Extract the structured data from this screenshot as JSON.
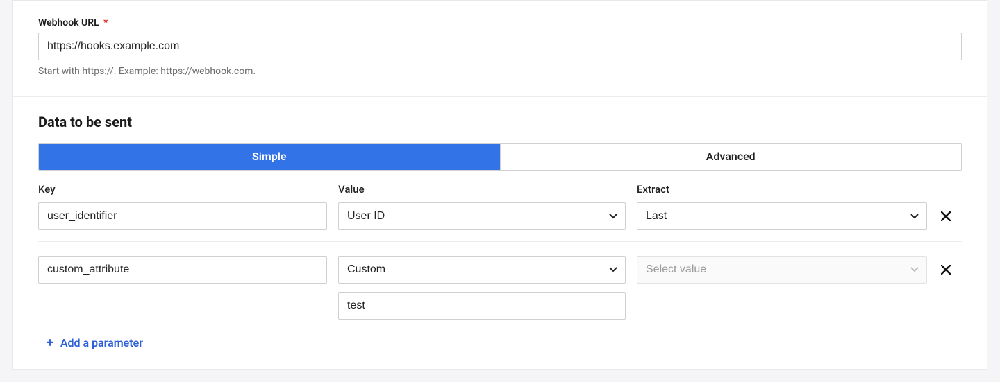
{
  "webhook": {
    "label": "Webhook URL",
    "required_marker": "*",
    "value": "https://hooks.example.com",
    "helper": "Start with https://. Example: https://webhook.com."
  },
  "data_section": {
    "title": "Data to be sent",
    "tabs": {
      "simple": "Simple",
      "advanced": "Advanced",
      "active": "simple"
    },
    "columns": {
      "key": "Key",
      "value": "Value",
      "extract": "Extract"
    },
    "rows": [
      {
        "key": "user_identifier",
        "value_selected": "User ID",
        "extract_selected": "Last",
        "extract_disabled": false,
        "custom_value": null
      },
      {
        "key": "custom_attribute",
        "value_selected": "Custom",
        "extract_selected": "Select value",
        "extract_disabled": true,
        "custom_value": "test"
      }
    ],
    "add_parameter": "Add a parameter"
  },
  "icons": {
    "caret": "chevron-down-icon",
    "close": "close-icon",
    "plus": "plus-icon"
  }
}
